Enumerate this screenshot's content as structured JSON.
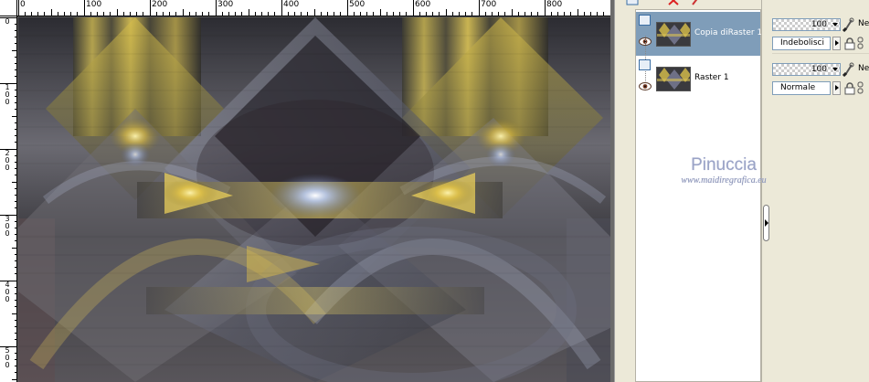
{
  "rulers": {
    "top_labels": [
      "0",
      "100",
      "200",
      "300",
      "400",
      "500",
      "600",
      "700",
      "800"
    ],
    "left_labels": [
      "0",
      "100",
      "200",
      "300",
      "400",
      "500"
    ]
  },
  "canvas": {
    "description_icon": "abstract-fractal-image",
    "colors": {
      "gold": "#e3c64a",
      "steel": "#7a8aa8",
      "dark": "#1a1a1e",
      "mauve": "#6a5256"
    }
  },
  "layers": [
    {
      "name": "Copia diRaster 1",
      "visible": true,
      "selected": true,
      "opacity": "100",
      "blend_mode": "Indebolisci",
      "mask_label": "Ne"
    },
    {
      "name": "Raster 1",
      "visible": true,
      "selected": false,
      "opacity": "100",
      "blend_mode": "Normale",
      "mask_label": "Ne"
    }
  ],
  "watermark": {
    "title": "Pinuccia",
    "url": "www.maidiregrafica.eu"
  },
  "toolbar": {
    "icons": [
      "new-layer-icon",
      "delete-icon",
      "brush-icon"
    ]
  }
}
